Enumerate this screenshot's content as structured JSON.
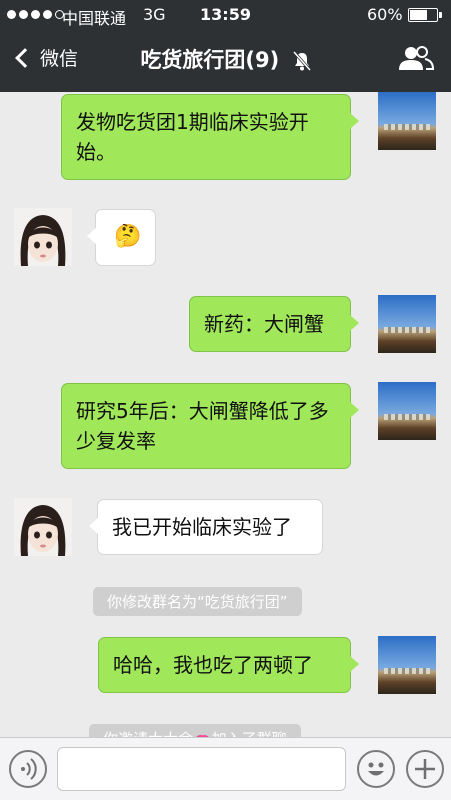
{
  "status_bar": {
    "carrier": "中国联通",
    "network": "3G",
    "time": "13:59",
    "battery": "60%",
    "battery_level": 0.6
  },
  "nav": {
    "back_label": "微信",
    "title": "吃货旅行团(9)",
    "icons": [
      "back-chevron-icon",
      "mute-bell-icon",
      "group-members-icon"
    ]
  },
  "messages": [
    {
      "side": "out",
      "text": "发物吃货团1期临床实验开始。"
    },
    {
      "side": "in",
      "text": "🤔"
    },
    {
      "side": "out",
      "text": "新药：大闸蟹"
    },
    {
      "side": "out",
      "text": "研究5年后：大闸蟹降低了多少复发率"
    },
    {
      "side": "in",
      "text": "我已开始临床实验了"
    },
    {
      "side": "system",
      "text": "你修改群名为“吃货旅行团”"
    },
    {
      "side": "out",
      "text": "哈哈，我也吃了两顿了"
    },
    {
      "side": "system",
      "text": "你邀请大大余🫦加入了群聊"
    }
  ],
  "input_bar": {
    "placeholder": "",
    "icons": [
      "voice-icon",
      "emoji-icon",
      "plus-icon"
    ]
  },
  "colors": {
    "nav_bg": "#2e3134",
    "chat_bg": "#ebebeb",
    "outgoing_bubble": "#a0e75a",
    "incoming_bubble": "#ffffff",
    "system_pill": "#cfcfcf"
  }
}
